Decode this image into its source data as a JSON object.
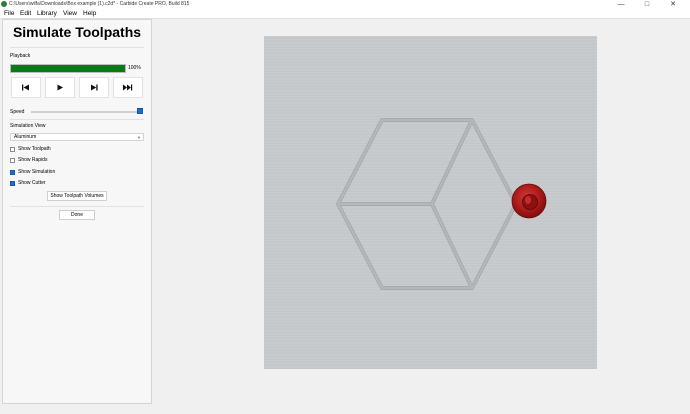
{
  "window": {
    "title": "C:\\Users\\wilfa\\Downloads\\Box example (1).c2d* - Carbide Create PRO, Build 815",
    "minimize": "—",
    "maximize": "□",
    "close": "✕"
  },
  "menu": {
    "file": "File",
    "edit": "Edit",
    "library": "Library",
    "view": "View",
    "help": "Help"
  },
  "panel": {
    "title": "Simulate Toolpaths",
    "playback_label": "Playback",
    "progress_percent": 100,
    "progress_text": "100%",
    "buttons": {
      "rewind": "⏮",
      "play": "▶",
      "step": "⏭",
      "fast_forward": "⏭"
    },
    "speed_label": "Speed",
    "speed_fraction": 1.0,
    "simulation_view_label": "Simulation View",
    "simulation_view_value": "Aluminum",
    "checkboxes": [
      {
        "label": "Show Toolpath",
        "checked": false
      },
      {
        "label": "Show Rapids",
        "checked": false
      },
      {
        "label": "Show Simulation",
        "checked": true
      },
      {
        "label": "Show Cutter",
        "checked": true
      }
    ],
    "volumes_button": "Show Toolpath Volumes",
    "done_button": "Done"
  },
  "viewport": {
    "material": "Aluminum",
    "cutter_color": "#b81c1c"
  }
}
